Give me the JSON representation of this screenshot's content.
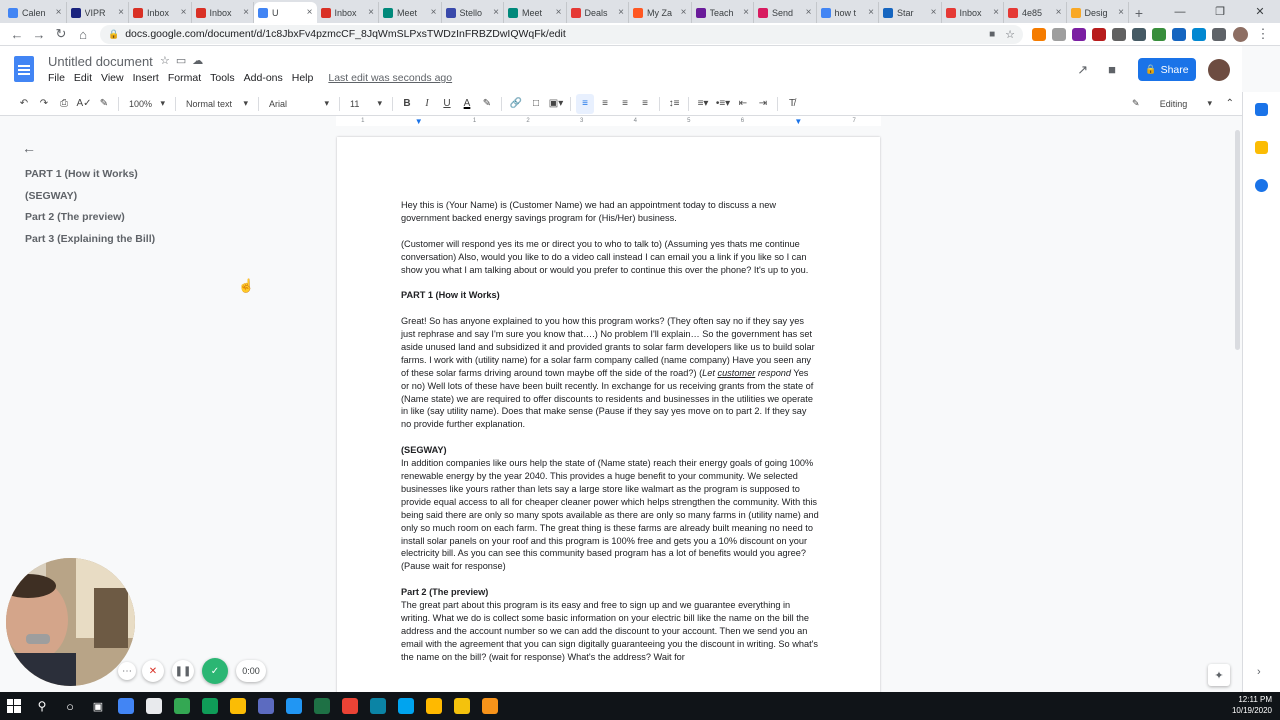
{
  "browser": {
    "tabs": [
      {
        "label": "Calen",
        "color": "#4285f4"
      },
      {
        "label": "VIPR",
        "color": "#1a237e"
      },
      {
        "label": "Inbox",
        "color": "#d93025"
      },
      {
        "label": "Inbox",
        "color": "#d93025"
      },
      {
        "label": "U",
        "color": "#4285f4",
        "active": true
      },
      {
        "label": "Inbox",
        "color": "#d93025"
      },
      {
        "label": "Meet",
        "color": "#00897b"
      },
      {
        "label": "Stello",
        "color": "#3949ab"
      },
      {
        "label": "Meet",
        "color": "#00897b"
      },
      {
        "label": "Deals",
        "color": "#e53935"
      },
      {
        "label": "My Za",
        "color": "#ff5722"
      },
      {
        "label": "Teach",
        "color": "#6a1b9a"
      },
      {
        "label": "Send",
        "color": "#d81b60"
      },
      {
        "label": "how t",
        "color": "#4285f4"
      },
      {
        "label": "Star",
        "color": "#1565c0"
      },
      {
        "label": "Inbox",
        "color": "#e53935"
      },
      {
        "label": "4e85",
        "color": "#e53935"
      },
      {
        "label": "Desig",
        "color": "#f9a825"
      }
    ],
    "new_tab": "+",
    "url": "docs.google.com/document/d/1c8JbxFv4pzmcCF_8JqWmSLPxsTWDzInFRBZDwIQWqFk/edit"
  },
  "docs": {
    "title": "Untitled document",
    "menu": [
      "File",
      "Edit",
      "View",
      "Insert",
      "Format",
      "Tools",
      "Add-ons",
      "Help"
    ],
    "last_edit": "Last edit was seconds ago",
    "share_label": "Share",
    "toolbar": {
      "zoom": "100%",
      "style": "Normal text",
      "font": "Arial",
      "size": "11",
      "mode": "Editing"
    }
  },
  "ruler_labels": [
    "1",
    "1",
    "2",
    "3",
    "4",
    "5",
    "6",
    "7"
  ],
  "outline": {
    "items": [
      "PART 1 (How it Works)",
      "(SEGWAY)",
      "Part 2 (The preview)",
      "Part 3 (Explaining the Bill)"
    ]
  },
  "document": {
    "p1": "Hey this is (Your Name) is (Customer Name) we had an appointment today to discuss a new government backed energy savings program for (His/Her) business.",
    "p2": "(Customer will respond yes its me or direct you to who to talk to) (Assuming yes thats me continue conversation) Also, would you like to do a video call instead I can email you a link if you like so I can show you what I am talking about or would you prefer to continue this over the phone? It's up to you.",
    "h1": "PART 1 (How it Works)",
    "p3a": "Great! So has anyone explained to you how this program works? (They often say no if they say yes just rephrase and say I'm sure you know that….) No problem I'll explain… So the government has set aside unused land and subsidized it and provided grants to solar farm developers like us to build solar farms. I work with (utility name) for a solar farm company called (name company) Have you seen any of these solar farms driving around town maybe off the side of the road?) (",
    "p3i1": "Let ",
    "p3i2": "customer",
    "p3i3": " respond",
    "p3b": " Yes or no) Well lots of these have been built recently. In exchange for us receiving grants from the state of (Name state) we are required to offer discounts to residents and businesses in the utilities we operate in like (say utility name). Does that make sense (Pause if they say yes move on to part 2. If they say no provide further explanation.",
    "h2": "(SEGWAY)",
    "p4": " In addition companies like ours help the state of (Name state) reach their energy goals of going 100% renewable energy by the year 2040. This provides a huge benefit to your community. We selected businesses like yours rather than lets say a large store like walmart as the program is supposed to provide equal access to all for cheaper cleaner power which helps strengthen the community. With this being said there are only so many spots available as there are only so many farms in (utility name) and only so much room on each farm. The great thing is these farms are already built meaning no need to install solar panels on your roof and this program is 100% free and gets you a 10% discount on your electricity bill. As you can see this community based program has a lot of benefits would you agree? (Pause wait for response)",
    "h3": "Part 2 (The preview)",
    "p5": "The great part about this program is its easy and free to sign up and we guarantee everything in writing. What we do is collect some basic information on your electric bill like the name on the bill the address and the account number so we can add the discount to your account. Then we send you an email with the agreement that you can sign digitally guaranteeing you the discount in writing. So what's the name on the bill? (wait for response) What's the address? Wait for"
  },
  "recorder": {
    "time": "0:00"
  },
  "taskbar": {
    "time": "12:11 PM",
    "date": "10/19/2020",
    "apps": [
      "#4285f4",
      "#e8eaed",
      "#34a853",
      "#0f9d58",
      "#fbbc05",
      "#5c6bc0",
      "#2196f3",
      "#1e7145",
      "#ea4335",
      "#0b84a5",
      "#00a4ef",
      "#ffb900",
      "#f4c20d",
      "#f7931a"
    ]
  },
  "colors": {
    "accent": "#1a73e8",
    "docs_blue": "#4285f4",
    "record_green": "#2bb673"
  }
}
